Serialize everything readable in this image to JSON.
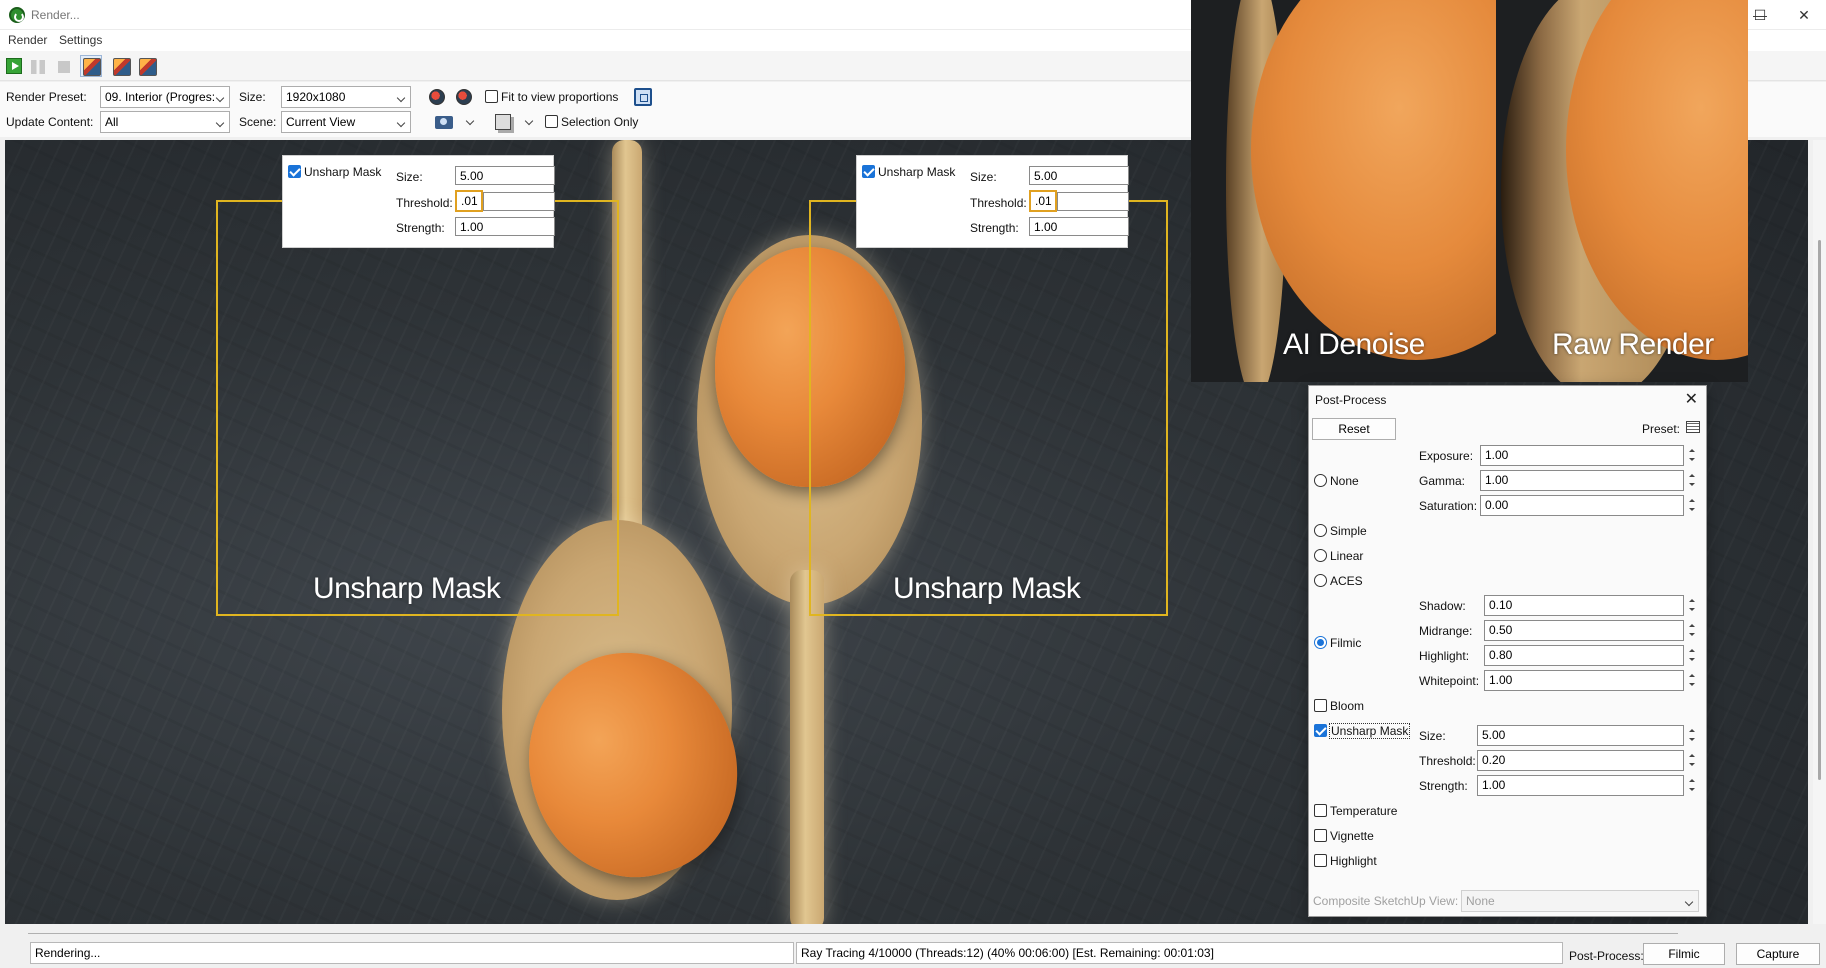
{
  "window": {
    "title": "Render..."
  },
  "menu": [
    "Render",
    "Settings"
  ],
  "toolbar": {
    "icons": [
      "play-icon",
      "pause-icon",
      "stop-icon",
      "save-image-icon",
      "export-icon",
      "print-icon"
    ]
  },
  "settings": {
    "render_preset_label": "Render Preset:",
    "render_preset_value": "09. Interior (Progres:",
    "size_label": "Size:",
    "size_value": "1920x1080",
    "fit_label": "Fit to view proportions",
    "update_label": "Update Content:",
    "update_value": "All",
    "scene_label": "Scene:",
    "scene_value": "Current View",
    "selection_label": "Selection Only"
  },
  "canvas": {
    "popup_left": {
      "checkbox_label": "Unsharp Mask",
      "size_label": "Size:",
      "size_value": "5.00",
      "threshold_label": "Threshold:",
      "threshold_value": ".01",
      "strength_label": "Strength:",
      "strength_value": "1.00"
    },
    "popup_right": {
      "checkbox_label": "Unsharp Mask",
      "size_label": "Size:",
      "size_value": "5.00",
      "threshold_label": "Threshold:",
      "threshold_value": ".01",
      "strength_label": "Strength:",
      "strength_value": "1.00"
    },
    "frame_left_label": "Unsharp Mask",
    "frame_right_label": "Unsharp Mask",
    "zoom_left_label": "AI Denoise",
    "zoom_right_label": "Raw Render",
    "accent_color": "#e0b520"
  },
  "postprocess": {
    "title": "Post-Process",
    "reset": "Reset",
    "preset_label": "Preset:",
    "tonemap": {
      "none": "None",
      "simple": "Simple",
      "linear": "Linear",
      "aces": "ACES",
      "filmic": "Filmic",
      "selected": "Filmic"
    },
    "exposure_label": "Exposure:",
    "exposure": "1.00",
    "gamma_label": "Gamma:",
    "gamma": "1.00",
    "saturation_label": "Saturation:",
    "saturation": "0.00",
    "shadow_label": "Shadow:",
    "shadow": "0.10",
    "midrange_label": "Midrange:",
    "midrange": "0.50",
    "highlight_label": "Highlight:",
    "highlight": "0.80",
    "whitepoint_label": "Whitepoint:",
    "whitepoint": "1.00",
    "bloom_label": "Bloom",
    "unsharp_label": "Unsharp Mask",
    "us_size_label": "Size:",
    "us_size": "5.00",
    "us_threshold_label": "Threshold:",
    "us_threshold": "0.20",
    "us_strength_label": "Strength:",
    "us_strength": "1.00",
    "temperature_label": "Temperature",
    "vignette_label": "Vignette",
    "highlight_fx_label": "Highlight",
    "composite_label": "Composite SketchUp View:",
    "composite_value": "None"
  },
  "status": {
    "state": "Rendering...",
    "progress": "Ray Tracing 4/10000 (Threads:12) (40% 00:06:00) [Est. Remaining: 00:01:03]",
    "postprocess_label": "Post-Process:",
    "postprocess_value": "Filmic",
    "capture": "Capture"
  }
}
